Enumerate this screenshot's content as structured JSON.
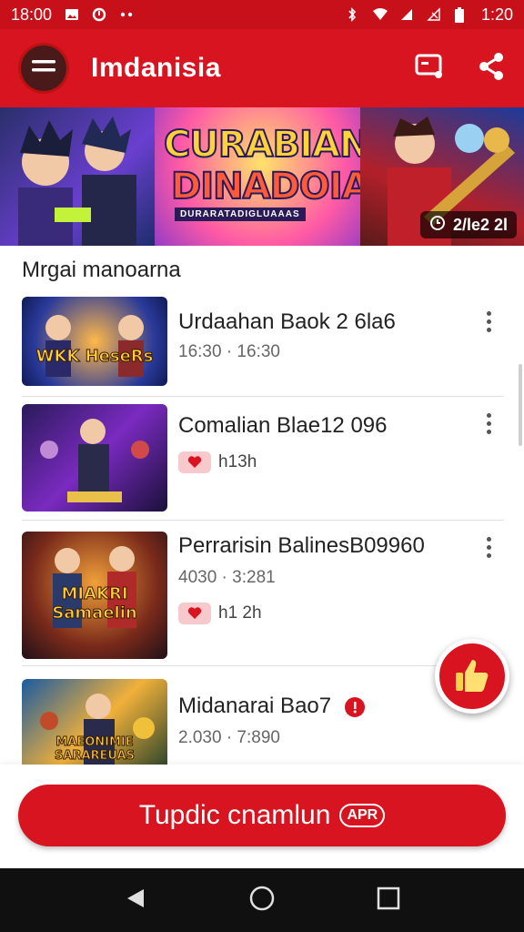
{
  "status_bar": {
    "time_left": "18:00",
    "time_right": "1:20",
    "icons": [
      "gallery-icon",
      "circle-notify-icon",
      "more-dots-icon",
      "bluetooth-icon",
      "wifi-icon",
      "signal-icon",
      "no-signal-icon",
      "battery-icon"
    ]
  },
  "app_bar": {
    "title": "Imdanisia",
    "icons": [
      "menu-icon",
      "cast-icon",
      "share-icon"
    ]
  },
  "banner": {
    "title_line1": "CURABIAN",
    "title_line2": "DINADOIA",
    "subtitle": "DURARATADIGLUAAAS",
    "badge_text": "2/le2 2l"
  },
  "section": {
    "title": "Mrgai manoarna"
  },
  "videos": [
    {
      "title": "Urdaahan Baok 2 6la6",
      "meta": "16:30 · 16:30",
      "thumb_label": "WKK HeseRs",
      "chip": ""
    },
    {
      "title": "Comalian Blae12 096",
      "meta": "",
      "thumb_label": "",
      "chip": "h13h"
    },
    {
      "title": "Perrarisin BalinesB09960",
      "meta": "4030 · 3:281",
      "thumb_label": "MIAKRI Samaelin",
      "chip": "h1 2h"
    },
    {
      "title": "Midanarai Bao7",
      "meta": "2.030 · 7:890",
      "thumb_label": "MAEONIMIE SARAREUAS",
      "chip": ""
    }
  ],
  "cta": {
    "label": "Tupdic cnamlun",
    "badge": "APR"
  },
  "colors": {
    "accent": "#d7141f",
    "status_bar": "#c8101b",
    "nav_bar": "#101010"
  }
}
